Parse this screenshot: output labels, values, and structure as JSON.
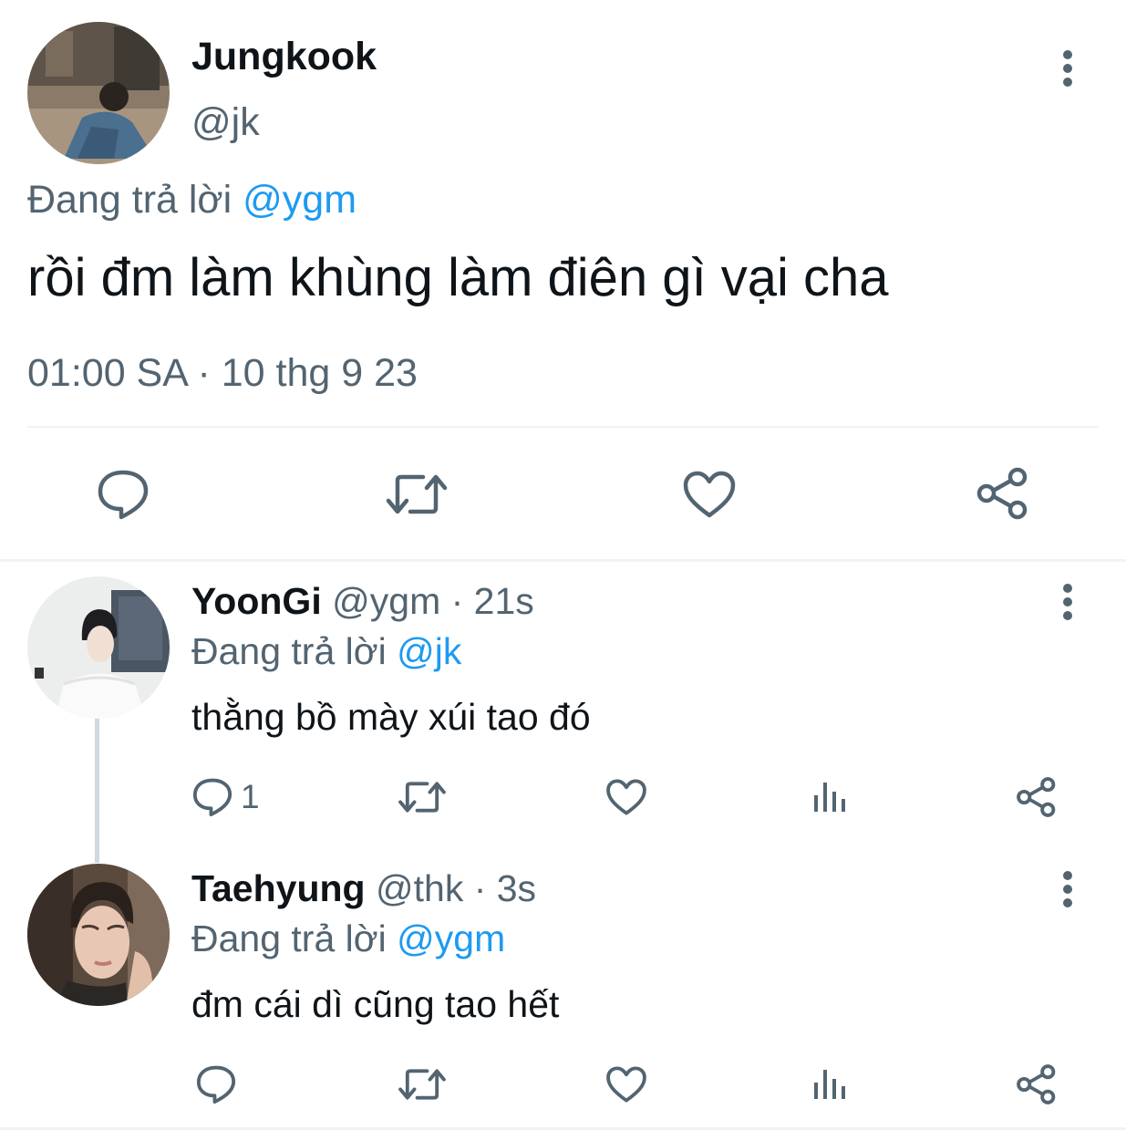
{
  "main_tweet": {
    "display_name": "Jungkook",
    "handle": "@jk",
    "replying_prefix": "Đang trả lời",
    "replying_to": "@ygm",
    "text": "rồi đm làm khùng làm điên gì vại cha",
    "timestamp": "01:00 SA · 10 thg 9 23",
    "actions": {
      "reply_icon": "reply-icon",
      "retweet_icon": "retweet-icon",
      "like_icon": "like-icon",
      "share_icon": "share-icon"
    }
  },
  "replies": [
    {
      "display_name": "YoonGi",
      "handle_meta": "@ygm · 21s",
      "replying_prefix": "Đang trả lời",
      "replying_to": "@jk",
      "text": "thằng bồ mày xúi tao đó",
      "reply_count": "1"
    },
    {
      "display_name": "Taehyung",
      "handle_meta": "@thk · 3s",
      "replying_prefix": "Đang trả lời",
      "replying_to": "@ygm",
      "text": "đm cái dì cũng tao hết",
      "reply_count": ""
    }
  ],
  "colors": {
    "primary_text": "#0f1419",
    "secondary_text": "#536471",
    "accent": "#1d9bf0",
    "divider": "#eff3f4",
    "thread_line": "#cfd9de"
  }
}
